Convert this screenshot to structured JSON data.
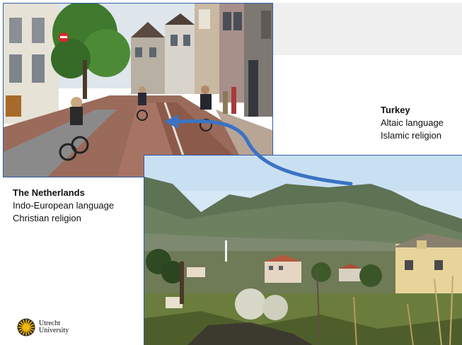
{
  "turkey": {
    "country": "Turkey",
    "language": "Altaic language",
    "religion": "Islamic religion"
  },
  "netherlands": {
    "country": "The Netherlands",
    "language": "Indo-European language",
    "religion": "Christian religion"
  },
  "logo": {
    "line1": "Utrecht",
    "line2": "University"
  },
  "colors": {
    "frame_blue": "#2e5fa8",
    "arrow_blue": "#3a73c4",
    "logo_yellow": "#f2b705"
  }
}
